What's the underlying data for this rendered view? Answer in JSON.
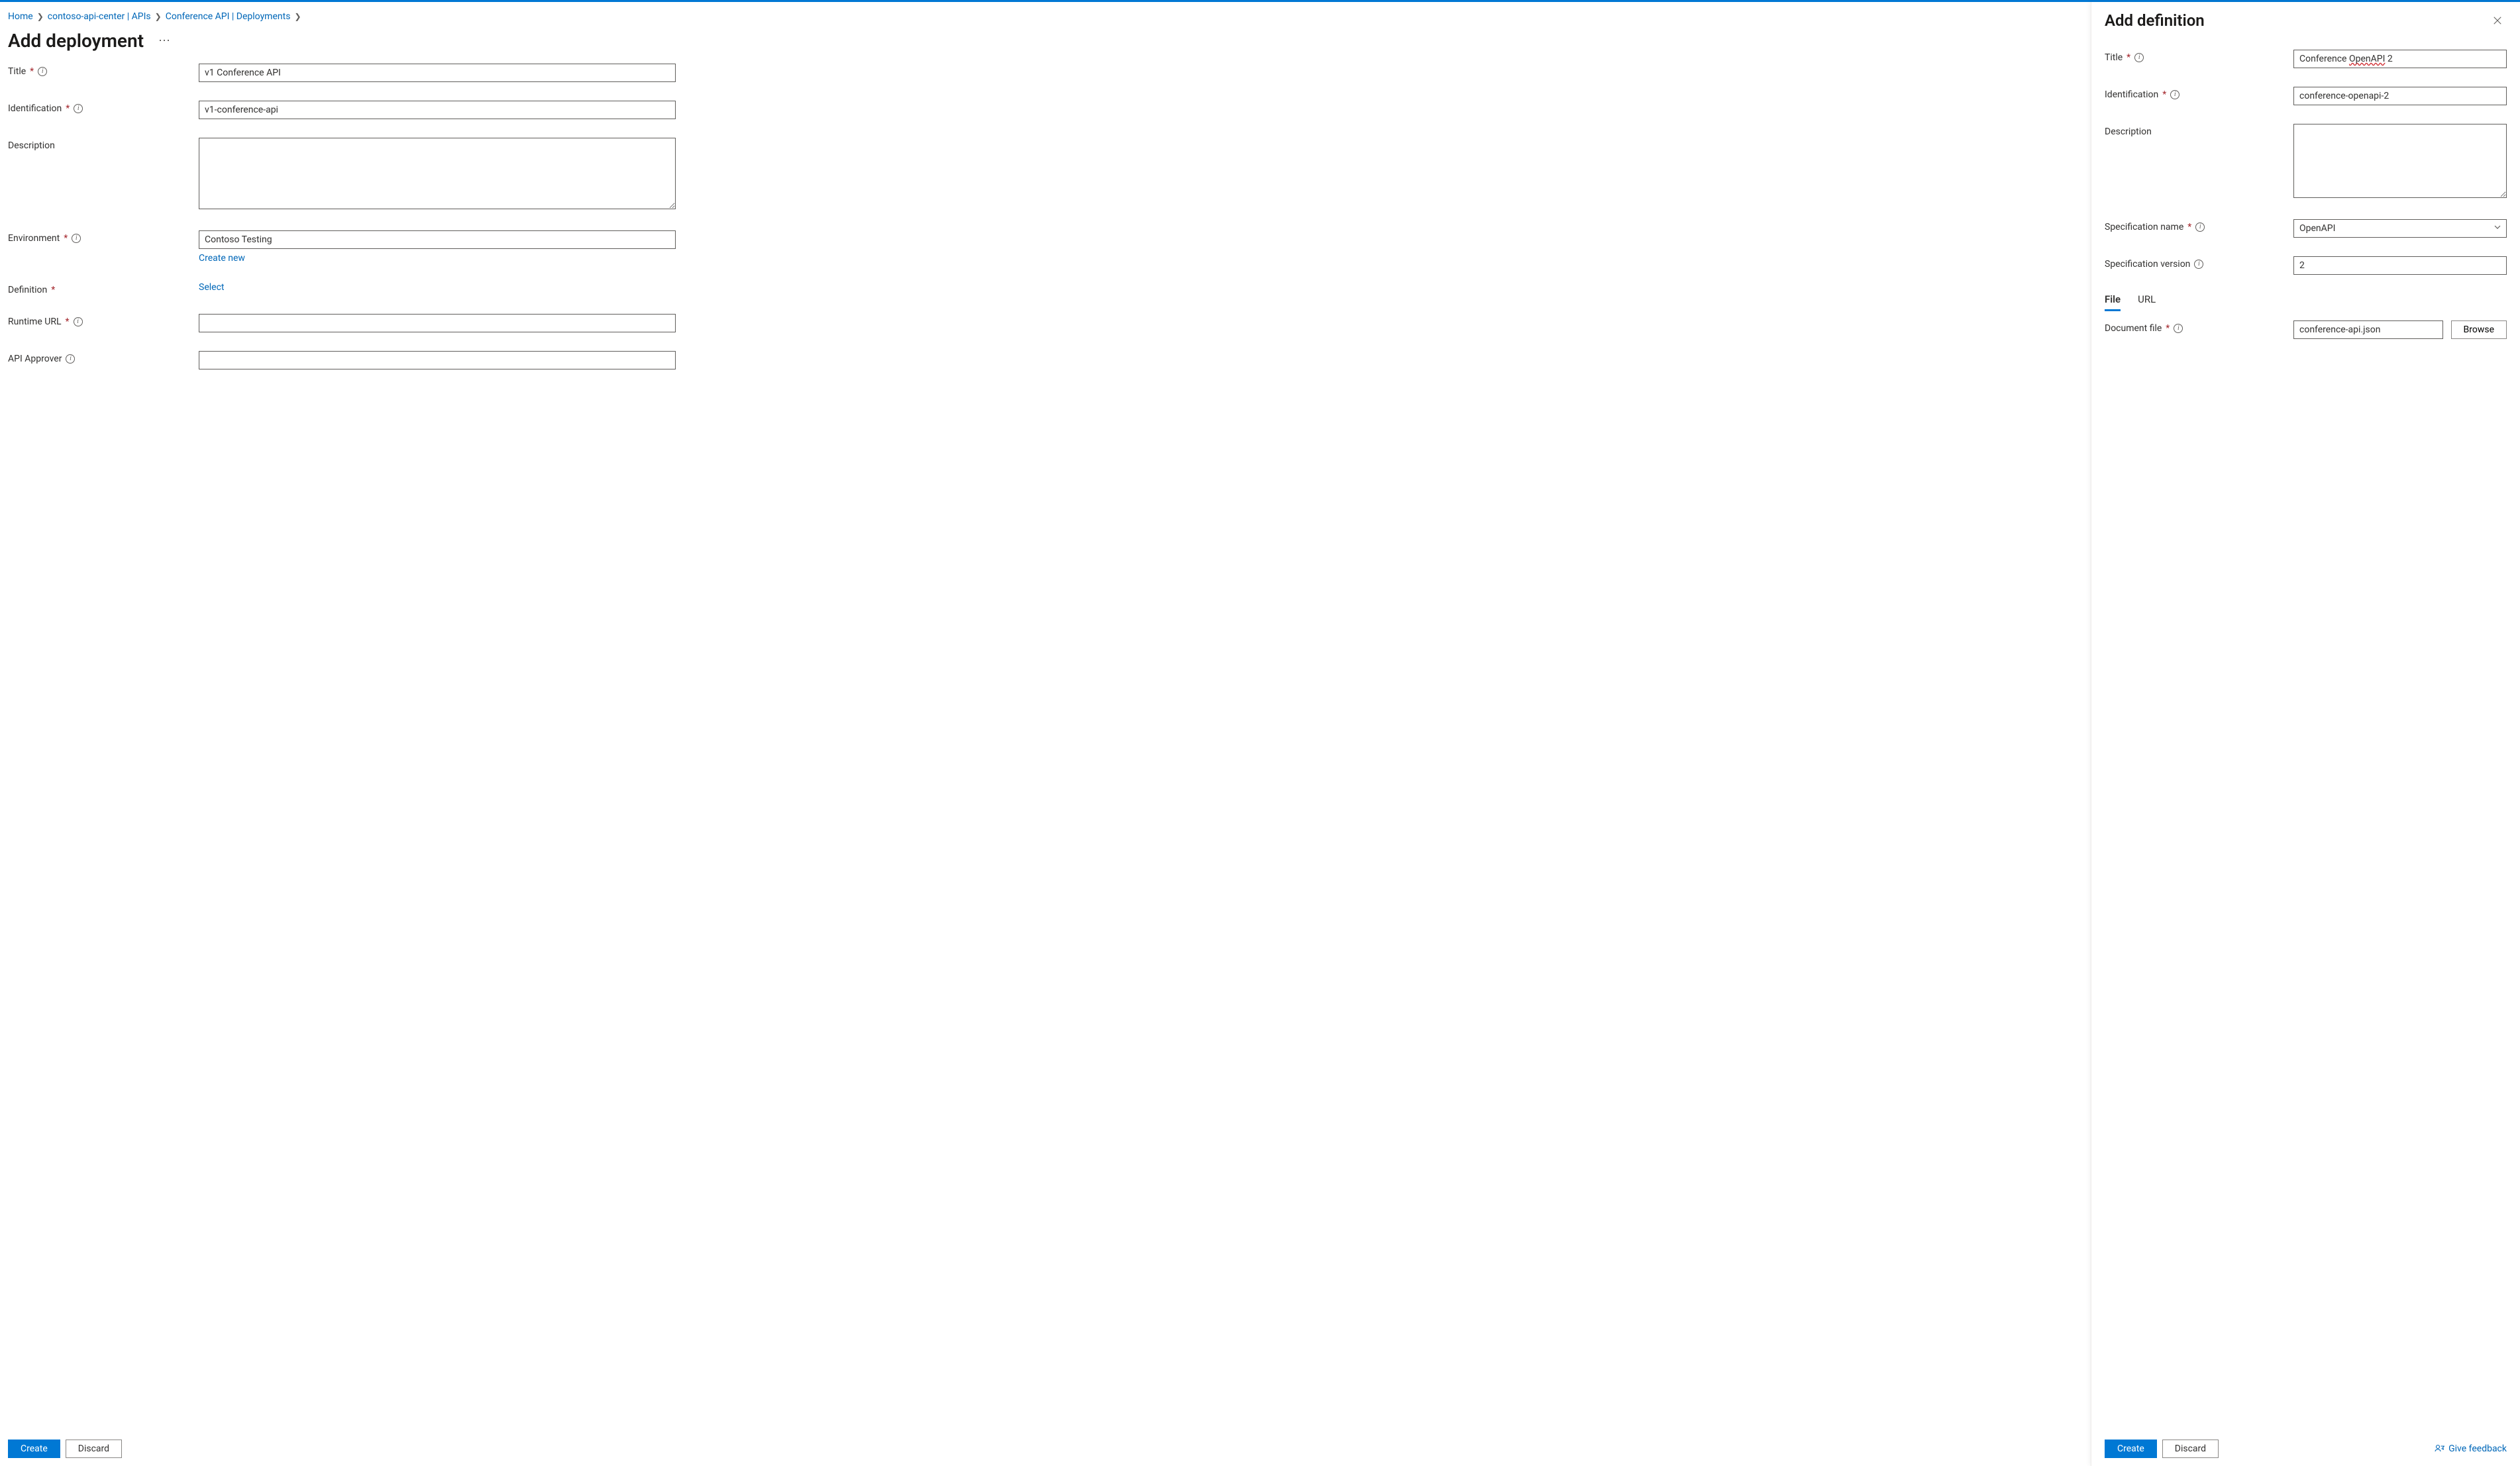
{
  "breadcrumbs": {
    "items": [
      {
        "label": "Home"
      },
      {
        "label": "contoso-api-center | APIs"
      },
      {
        "label": "Conference API | Deployments"
      }
    ]
  },
  "page": {
    "title": "Add deployment"
  },
  "form": {
    "title": {
      "label": "Title",
      "value": "v1 Conference API"
    },
    "identification": {
      "label": "Identification",
      "value": "v1-conference-api"
    },
    "description": {
      "label": "Description",
      "value": ""
    },
    "environment": {
      "label": "Environment",
      "value": "Contoso Testing",
      "create_new": "Create new"
    },
    "definition": {
      "label": "Definition",
      "select_link": "Select"
    },
    "runtime_url": {
      "label": "Runtime URL",
      "value": ""
    },
    "api_approver": {
      "label": "API Approver",
      "value": ""
    }
  },
  "buttons": {
    "create": "Create",
    "discard": "Discard",
    "browse": "Browse"
  },
  "panel": {
    "title": "Add definition",
    "form": {
      "title": {
        "label": "Title",
        "value_plain": "Conference ",
        "value_squiggle": "OpenAPI",
        "value_tail": " 2"
      },
      "identification": {
        "label": "Identification",
        "value": "conference-openapi-2"
      },
      "description": {
        "label": "Description",
        "value": ""
      },
      "spec_name": {
        "label": "Specification name",
        "value": "OpenAPI"
      },
      "spec_version": {
        "label": "Specification version",
        "value": "2"
      },
      "doc_file": {
        "label": "Document file",
        "value": "conference-api.json"
      }
    },
    "tabs": {
      "file": "File",
      "url": "URL"
    },
    "feedback": "Give feedback"
  }
}
